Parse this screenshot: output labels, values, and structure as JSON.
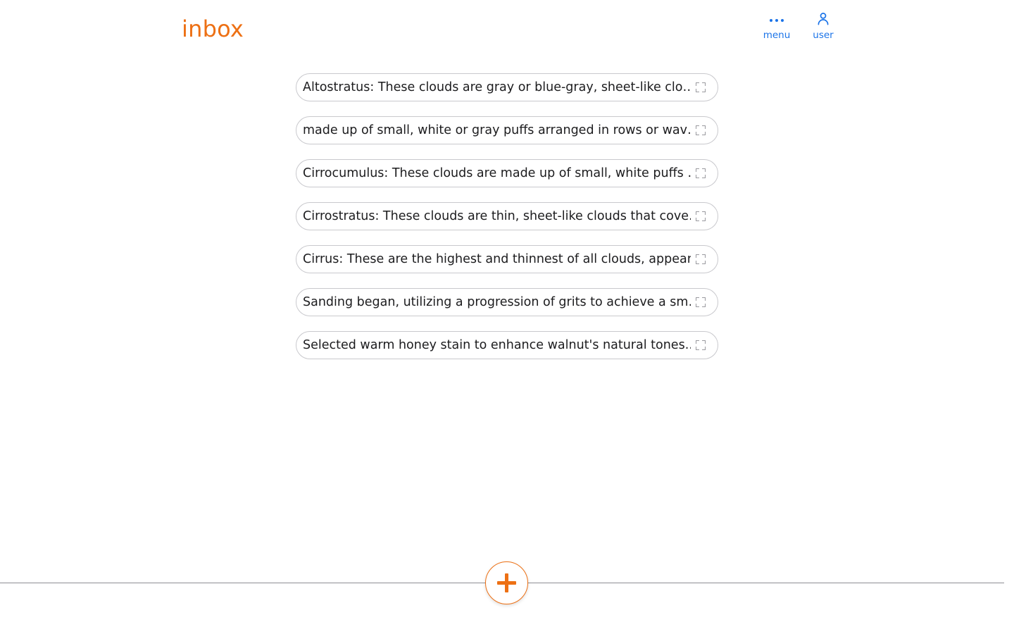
{
  "header": {
    "title": "inbox",
    "title_color": "#ED7014",
    "actions": [
      {
        "label": "menu",
        "icon": "three-dots-icon",
        "color": "#1a73e8"
      },
      {
        "label": "user",
        "icon": "user-avatar-icon",
        "color": "#1a73e8"
      }
    ]
  },
  "list": {
    "items": [
      {
        "text": "Altostratus: These clouds are gray or blue-gray, sheet-like clo…",
        "action_icon": "expand-icon"
      },
      {
        "text": "made up of small, white or gray puffs arranged in rows or wav…",
        "action_icon": "expand-icon"
      },
      {
        "text": "Cirrocumulus: These clouds are made up of small, white puffs …",
        "action_icon": "expand-icon"
      },
      {
        "text": "Cirrostratus: These clouds are thin, sheet-like clouds that cove…",
        "action_icon": "expand-icon"
      },
      {
        "text": "Cirrus: These are the highest and thinnest of all clouds, appear…",
        "action_icon": "expand-icon"
      },
      {
        "text": "Sanding began, utilizing a progression of grits to achieve a sm…",
        "action_icon": "expand-icon"
      },
      {
        "text": "Selected warm honey stain to enhance walnut's natural tones.…",
        "action_icon": "expand-icon"
      }
    ]
  },
  "footer": {
    "add_button": {
      "icon": "plus-icon",
      "label": "+",
      "color": "#ED7014"
    }
  }
}
